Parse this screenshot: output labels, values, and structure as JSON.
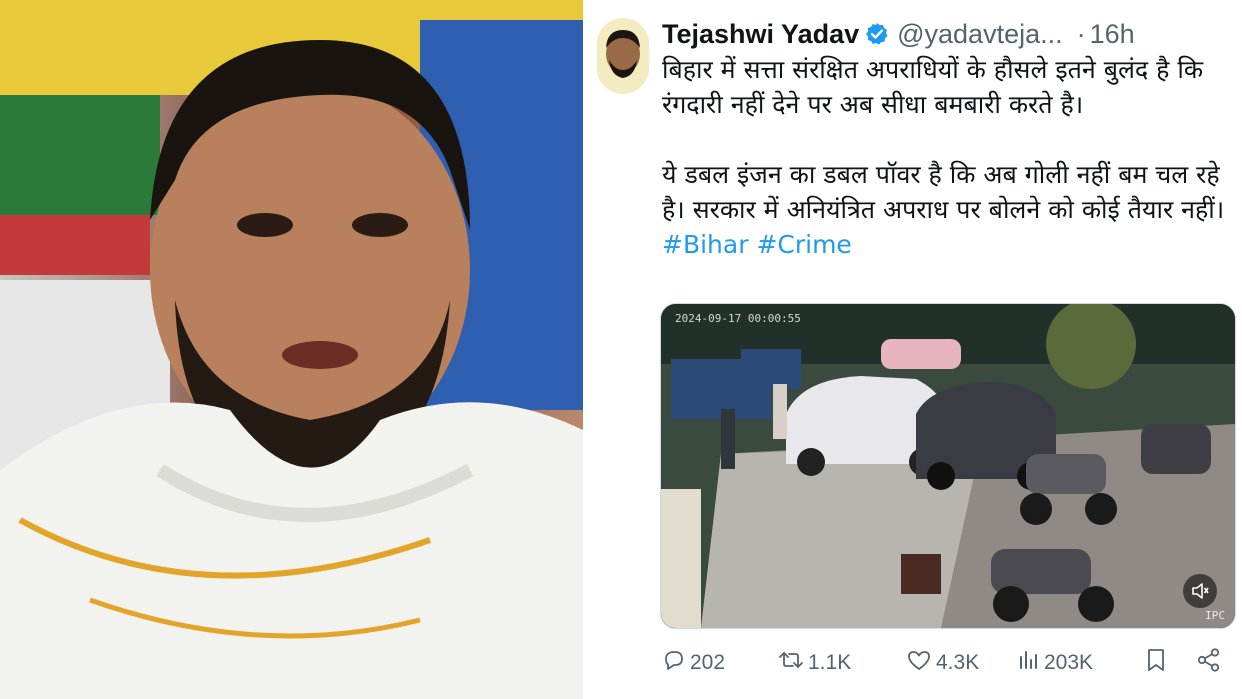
{
  "tweet": {
    "author_name": "Tejashwi Yadav",
    "handle": "@yadavteja...",
    "separator": "·",
    "time": "16h",
    "paragraph1": "बिहार में सत्ता संरक्षित अपराधियों के हौसले इतने बुलंद है कि रंगदारी नहीं देने पर अब सीधा बमबारी करते है।",
    "paragraph2": "ये डबल इंजन का डबल पॉवर है कि अब गोली नहीं बम चल रहे है। सरकार में अनियंत्रित अपराध पर बोलने को कोई तैयार नहीं।",
    "hashtags": [
      "#Bihar",
      "#Crime"
    ],
    "media": {
      "timestamp": "2024-09-17 00:00:55",
      "corner_label": "IPC"
    },
    "actions": {
      "replies": "202",
      "retweets": "1.1K",
      "likes": "4.3K",
      "views": "203K"
    }
  },
  "icons": [
    "verified-badge-icon",
    "reply-icon",
    "retweet-icon",
    "like-icon",
    "views-icon",
    "bookmark-icon",
    "share-icon",
    "volume-icon"
  ],
  "colors": {
    "accent": "#1d9bf0",
    "text": "#0f1419",
    "muted": "#536471"
  }
}
